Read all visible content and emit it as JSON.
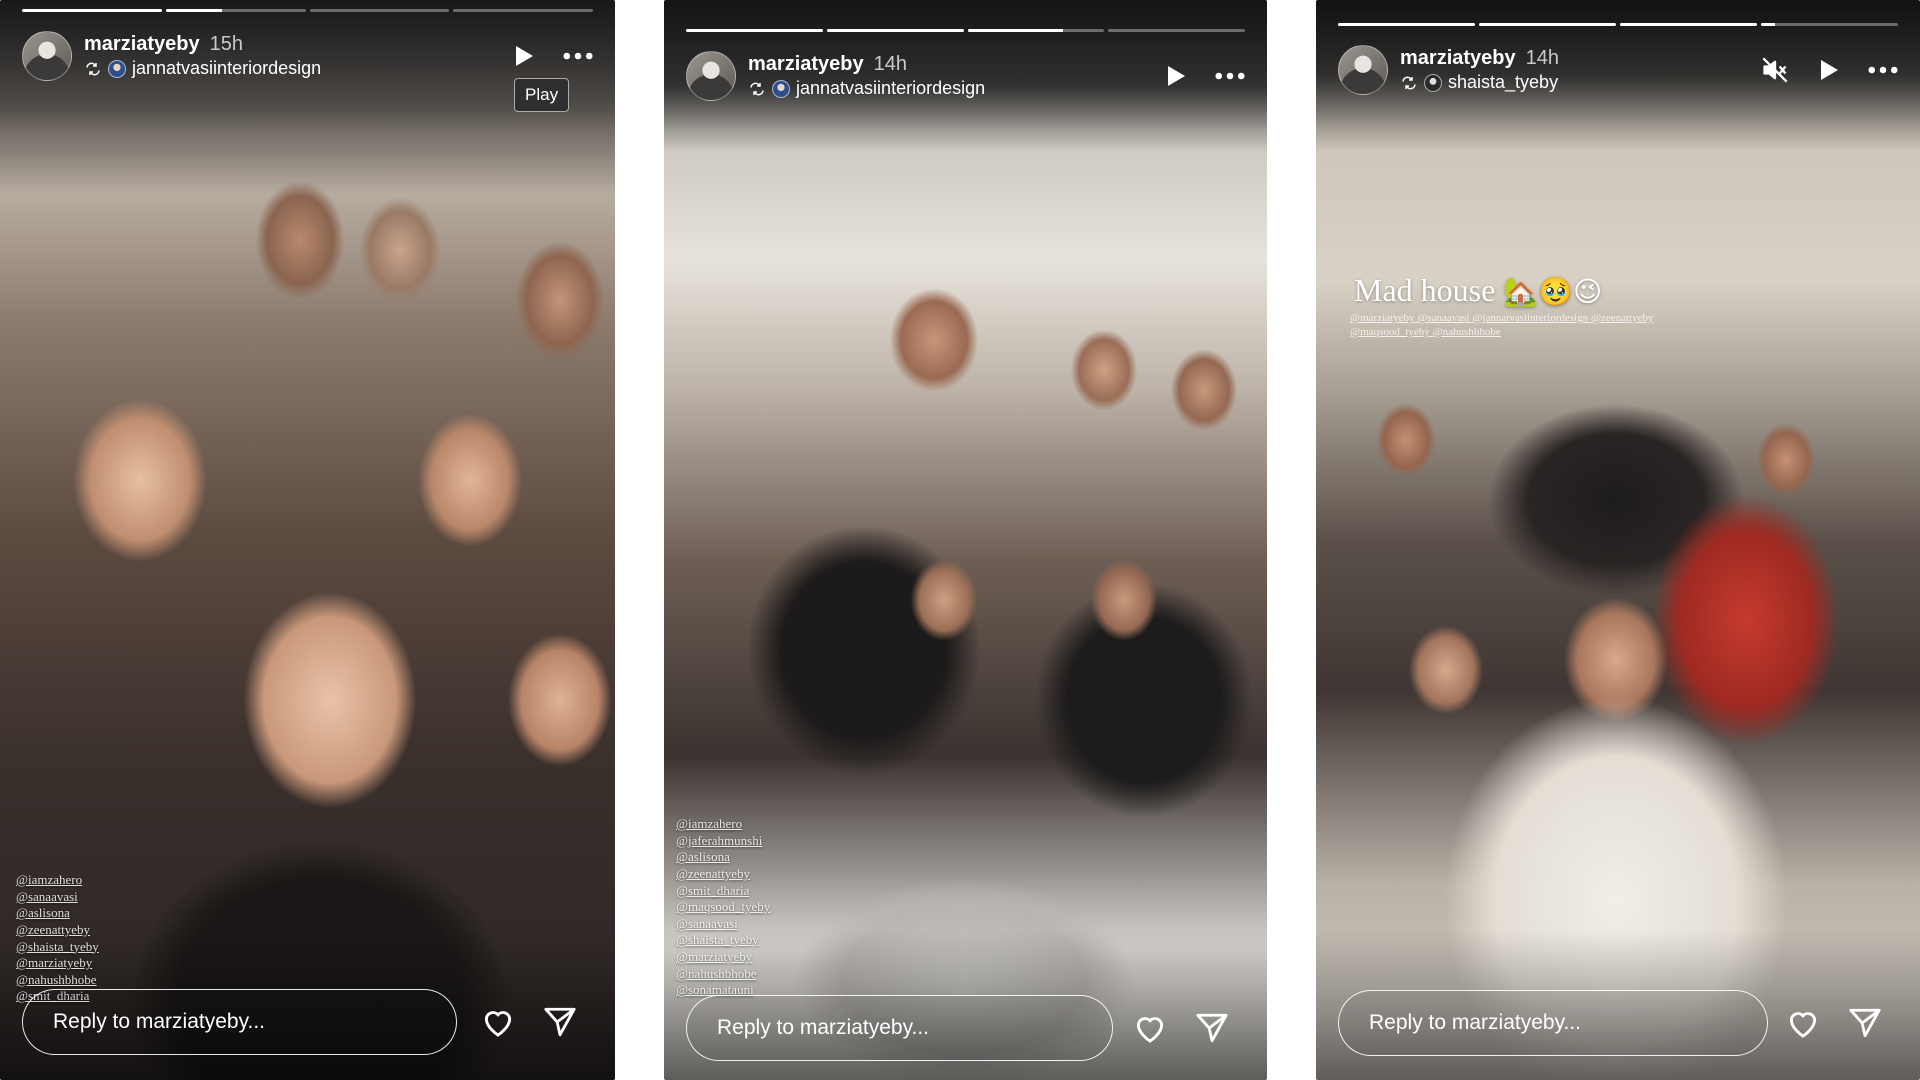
{
  "stories": [
    {
      "username": "marziatyeby",
      "time": "15h",
      "reposted_from": "jannatvasiinteriordesign",
      "progress": [
        1.0,
        0.4,
        0.0,
        0.0
      ],
      "tooltip": "Play",
      "tags": [
        "@iamzahero",
        "@sanaavasi",
        "@aslisona",
        "@zeenattyeby",
        "@shaista_tyeby",
        "@marziatyeby",
        "@nahushbhobe",
        "@smit_dharia"
      ],
      "reply_placeholder": "Reply to marziatyeby..."
    },
    {
      "username": "marziatyeby",
      "time": "14h",
      "reposted_from": "jannatvasiinteriordesign",
      "progress": [
        1.0,
        1.0,
        0.7,
        0.0
      ],
      "tags": [
        "@iamzahero",
        "@jaferahmunshi",
        "@aslisona",
        "@zeenattyeby",
        "@smit_dharia",
        "@maqsood_tyeby",
        "@sanaavasi",
        "@shaista_tyeby",
        "@marziatyeby",
        "@nahushbhobe",
        "@sonamatauni"
      ],
      "reply_placeholder": "Reply to marziatyeby..."
    },
    {
      "username": "marziatyeby",
      "time": "14h",
      "reposted_from": "shaista_tyeby",
      "progress": [
        1.0,
        1.0,
        1.0,
        0.1
      ],
      "caption": "Mad house",
      "caption_emoji": "🏡🥹😉",
      "caption_tags": "@marziatyeby @sanaavasi @jannatvasiinteriordesign @zeenattyeby @maqsood_tyeby @nahushbhobe",
      "reply_placeholder": "Reply to marziatyeby..."
    }
  ],
  "icons": {
    "play": "play-icon",
    "more": "more-icon",
    "mute": "mute-icon",
    "like": "heart-icon",
    "share": "send-icon",
    "repost": "repost-icon"
  }
}
